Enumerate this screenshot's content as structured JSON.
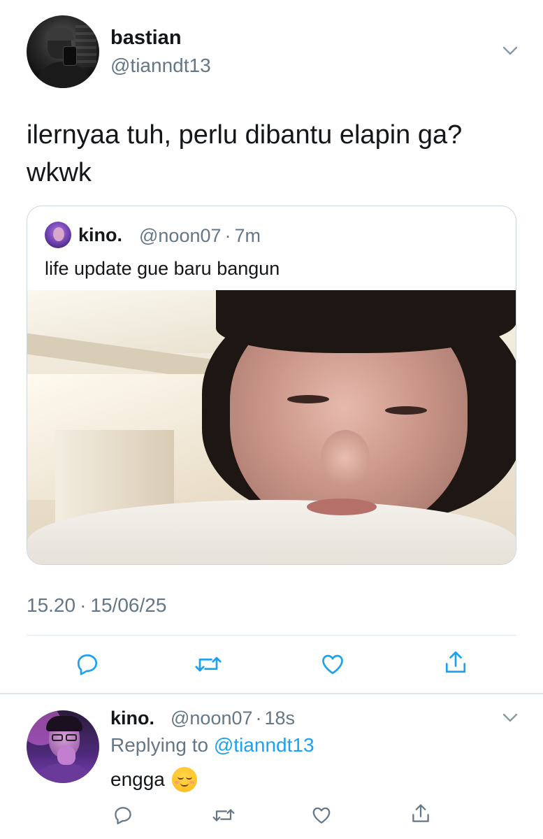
{
  "main_tweet": {
    "display_name": "bastian",
    "handle": "@tianndt13",
    "text": "ilernyaa tuh, perlu dibantu elapin ga? wkwk",
    "time": "15.20",
    "separator": "·",
    "date": "15/06/25"
  },
  "quoted_tweet": {
    "display_name": "kino.",
    "handle": "@noon07",
    "separator": "·",
    "age": "7m",
    "text": "life update gue baru bangun"
  },
  "reply_tweet": {
    "display_name": "kino.",
    "handle": "@noon07",
    "separator": "·",
    "age": "18s",
    "replying_prefix": "Replying to",
    "replying_mention": "@tianndt13",
    "text": "engga"
  },
  "icons": {
    "reply": "reply-icon",
    "retweet": "retweet-icon",
    "like": "heart-icon",
    "share": "share-icon",
    "menu": "chevron-down-icon",
    "emoji": "relieved-face-emoji"
  },
  "colors": {
    "text": "#14171a",
    "secondary": "#657786",
    "link": "#1da1f2",
    "border": "#ccd6dd",
    "divider": "#e1e8ed"
  }
}
